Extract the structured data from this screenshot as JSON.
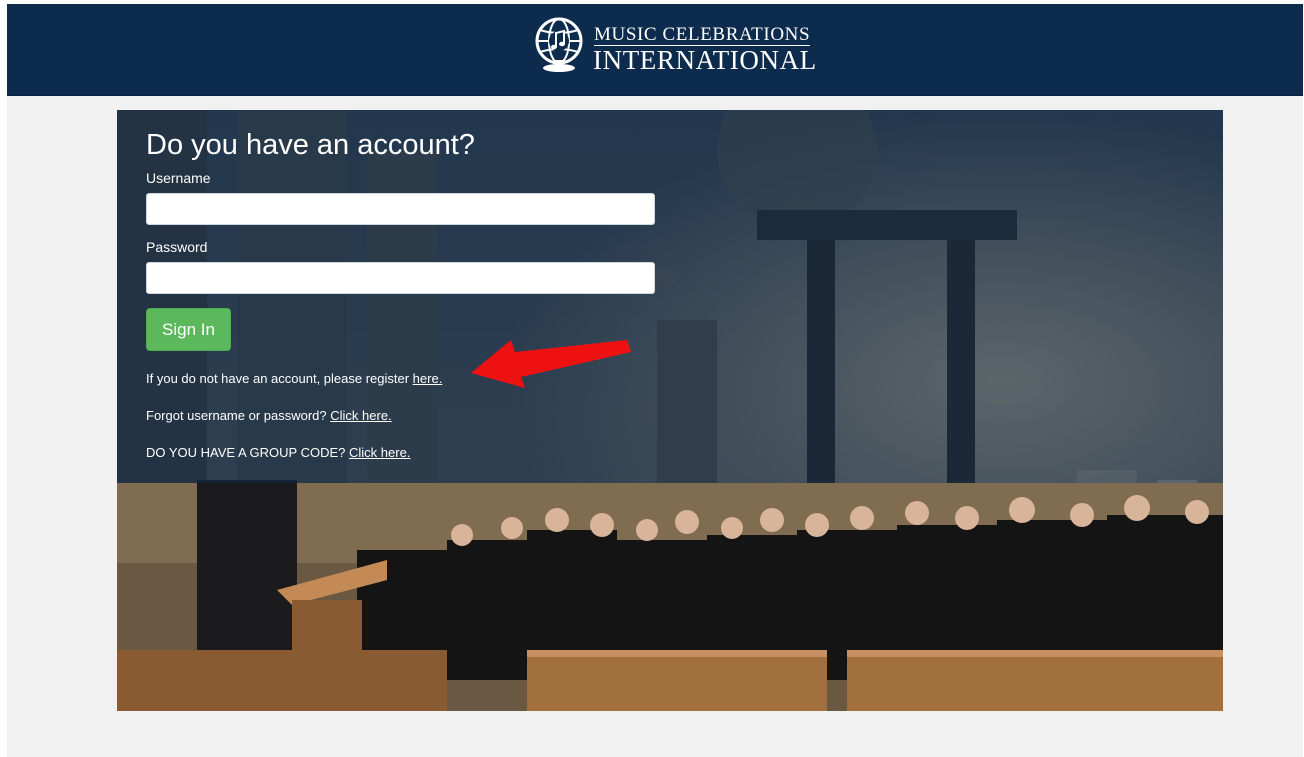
{
  "header": {
    "logo_line1": "MUSIC CELEBRATIONS",
    "logo_line2": "INTERNATIONAL"
  },
  "login": {
    "title": "Do you have an account?",
    "username_label": "Username",
    "username_value": "",
    "password_label": "Password",
    "password_value": "",
    "signin_label": "Sign In",
    "register_text": "If you do not have an account, please register ",
    "register_link": "here.",
    "forgot_text": "Forgot username or password? ",
    "forgot_link": "Click here.",
    "group_code_text": "DO YOU HAVE A GROUP CODE? ",
    "group_code_link": "Click here."
  },
  "colors": {
    "header_bg": "#0d2c4d",
    "signin_button": "#5cb85c",
    "annotation_arrow": "#ee1111"
  }
}
